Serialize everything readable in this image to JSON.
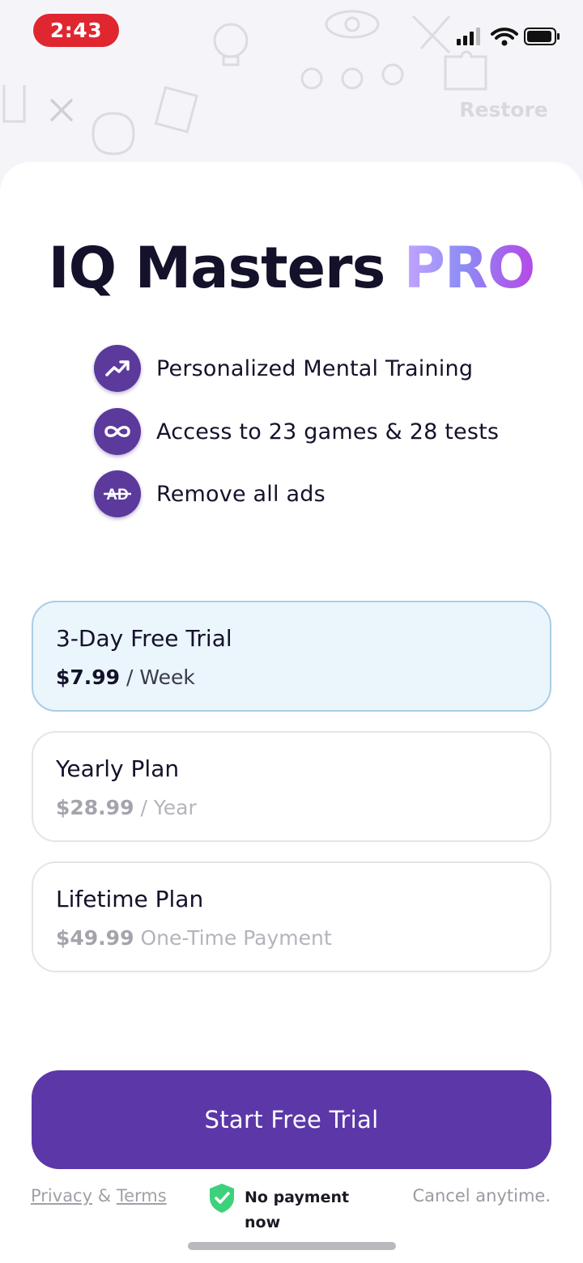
{
  "status_bar": {
    "time": "2:43"
  },
  "header": {
    "close_icon": "close-icon",
    "restore_label": "Restore"
  },
  "title": {
    "main": "IQ Masters",
    "accent": "PRO"
  },
  "features": [
    {
      "icon": "trending-up-icon",
      "label": "Personalized Mental Training"
    },
    {
      "icon": "infinity-icon",
      "label": "Access to 23 games & 28 tests"
    },
    {
      "icon": "no-ads-icon",
      "label": "Remove all ads"
    }
  ],
  "plans": [
    {
      "name": "3-Day Free Trial",
      "price": "$7.99",
      "period": "/ Week",
      "selected": true
    },
    {
      "name": "Yearly Plan",
      "price": "$28.99",
      "period": "/ Year",
      "selected": false
    },
    {
      "name": "Lifetime Plan",
      "price": "$49.99",
      "period": "One-Time Payment",
      "selected": false
    }
  ],
  "cta": {
    "label": "Start Free Trial"
  },
  "footer": {
    "privacy": "Privacy",
    "ampersand": "&",
    "terms": "Terms",
    "no_payment": "No payment now",
    "cancel": "Cancel anytime."
  },
  "colors": {
    "accent": "#5c37a8",
    "selected_plan_bg": "#eaf6fc",
    "selected_plan_border": "#a9cde6",
    "status_time_bg": "#e0262f",
    "shield": "#3dd17c"
  }
}
